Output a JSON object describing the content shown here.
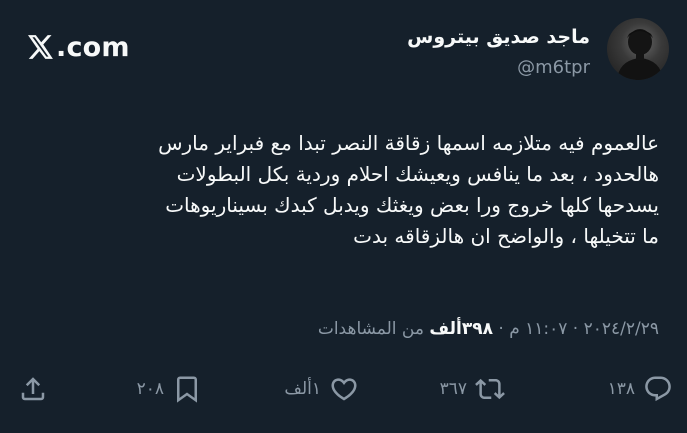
{
  "header": {
    "logo_text": "𝕏.com",
    "logo_icon": "x-logo-icon",
    "display_name": "ماجد صديق بيتروس",
    "handle": "@m6tpr",
    "avatar": "profile-avatar"
  },
  "tweet": {
    "lines": [
      "عالعموم فيه متلازمه اسمها زقاقة النصر تبدا مع فبراير مارس",
      "هالحدود ، بعد ما ينافس ويعيشك احلام وردية بكل البطولات",
      "يسدحها كلها خروج ورا بعض ويغثك ويدبل كبدك بسيناريوهات",
      "ما تتخيلها ، والواضح ان هالزقاقه بدت"
    ]
  },
  "meta": {
    "date": "٢٠٢٤/٢/٢٩",
    "separator": " · ",
    "time": "١١:٠٧ م",
    "views_count": "٣٩٨ألف",
    "views_label": " من المشاهدات"
  },
  "actions": {
    "reply": {
      "icon": "reply-icon",
      "count": "١٣٨"
    },
    "retweet": {
      "icon": "retweet-icon",
      "count": "٣٦٧"
    },
    "like": {
      "icon": "heart-icon",
      "count": "١ألف"
    },
    "bookmark": {
      "icon": "bookmark-icon",
      "count": "٢٠٨"
    },
    "share": {
      "icon": "share-icon",
      "count": ""
    }
  },
  "colors": {
    "background": "#15202b",
    "text_primary": "#f7f9f9",
    "text_secondary": "#8b98a5"
  }
}
